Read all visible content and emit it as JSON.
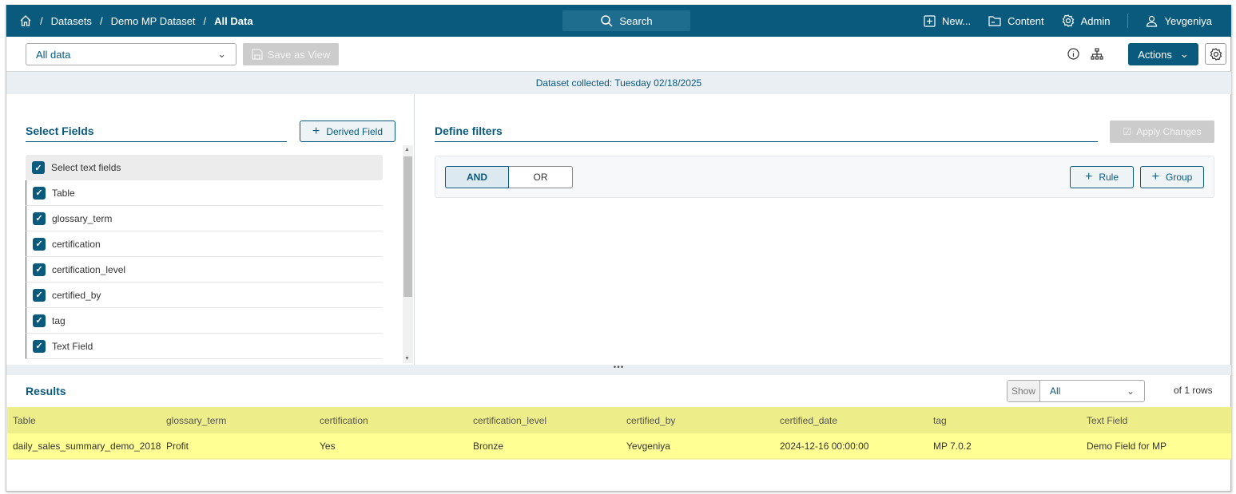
{
  "breadcrumb": {
    "items": [
      "Datasets",
      "Demo MP Dataset"
    ],
    "current": "All Data"
  },
  "search": {
    "label": "Search"
  },
  "nav": {
    "new": "New...",
    "content": "Content",
    "admin": "Admin",
    "user": "Yevgeniya"
  },
  "toolbar": {
    "view_select": "All data",
    "save_view": "Save as View",
    "actions": "Actions"
  },
  "banner": "Dataset collected: Tuesday 02/18/2025",
  "fields": {
    "title": "Select Fields",
    "derived": "Derived Field",
    "items": [
      "Select text fields",
      "Table",
      "glossary_term",
      "certification",
      "certification_level",
      "certified_by",
      "tag",
      "Text Field"
    ]
  },
  "filters": {
    "title": "Define filters",
    "apply": "Apply Changes",
    "and": "AND",
    "or": "OR",
    "rule": "Rule",
    "group": "Group"
  },
  "results": {
    "title": "Results",
    "show_label": "Show",
    "show_value": "All",
    "rows_text": "of 1 rows",
    "columns": [
      "Table",
      "glossary_term",
      "certification",
      "certification_level",
      "certified_by",
      "certified_date",
      "tag",
      "Text Field"
    ],
    "rows": [
      [
        "daily_sales_summary_demo_2018",
        "Profit",
        "Yes",
        "Bronze",
        "Yevgeniya",
        "2024-12-16 00:00:00",
        "MP 7.0.2",
        "Demo Field for MP"
      ]
    ]
  },
  "colors": {
    "brand": "#0a5a7e",
    "row_highlight": "#ffff93"
  }
}
